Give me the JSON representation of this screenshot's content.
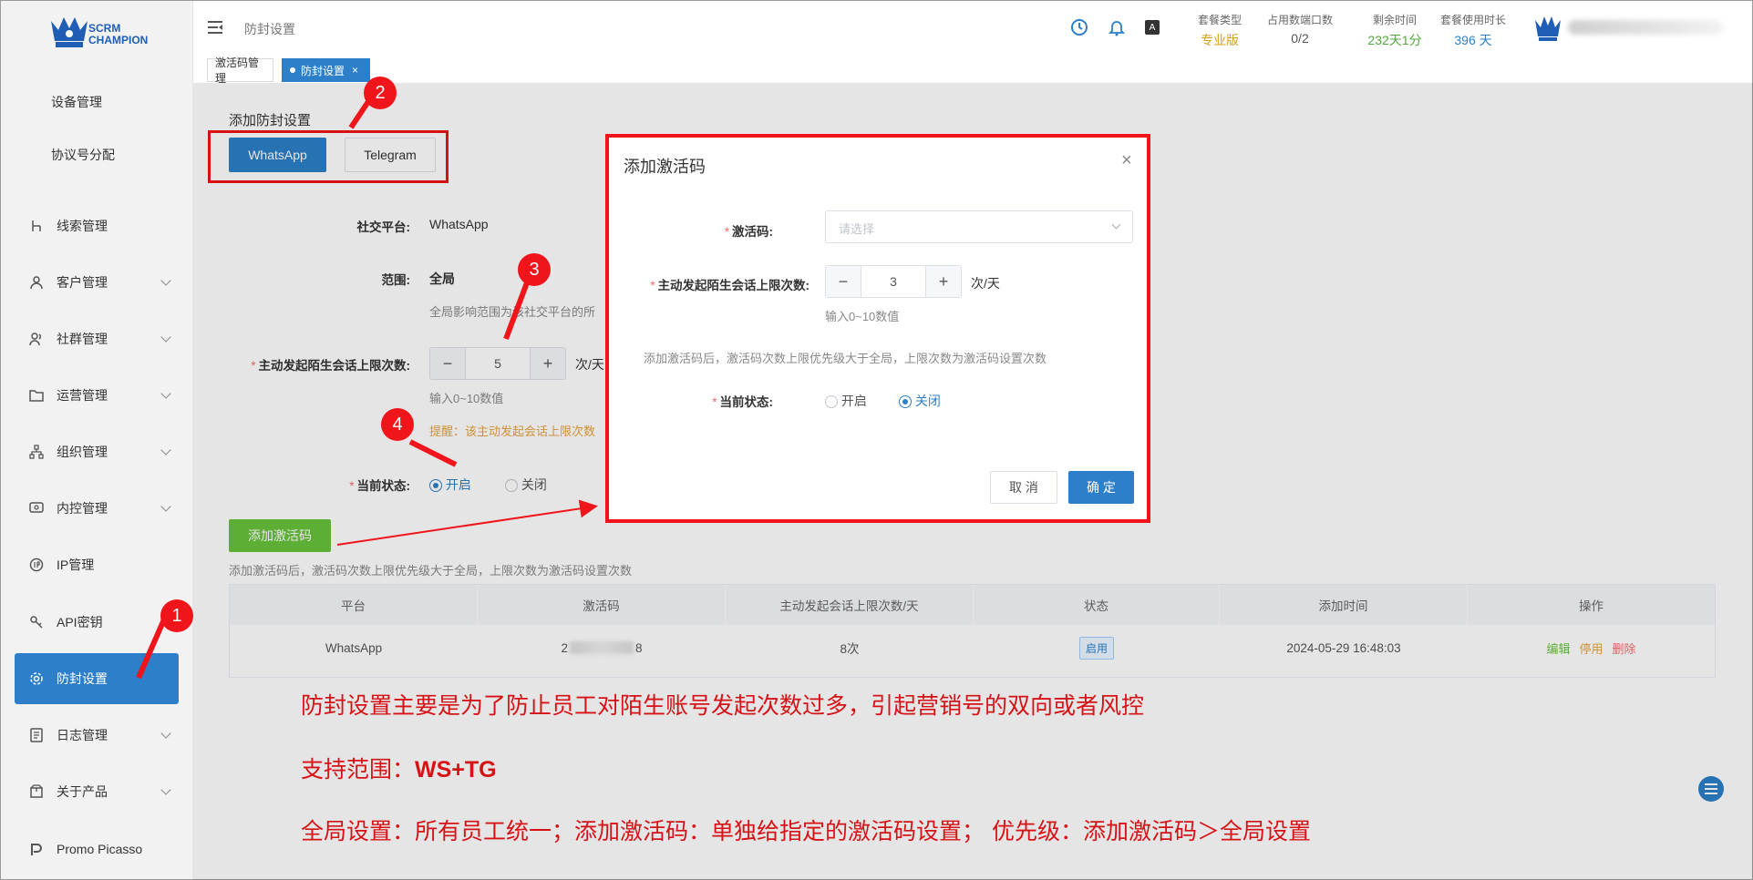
{
  "app": {
    "logo_line1": "SCRM",
    "logo_line2": "CHAMPION"
  },
  "sidebar": {
    "sub_items": [
      "设备管理",
      "协议号分配"
    ],
    "items": [
      {
        "label": "线索管理",
        "icon": "branch-icon",
        "has_children": false
      },
      {
        "label": "客户管理",
        "icon": "user-icon",
        "has_children": true
      },
      {
        "label": "社群管理",
        "icon": "users-icon",
        "has_children": true
      },
      {
        "label": "运营管理",
        "icon": "folder-icon",
        "has_children": true
      },
      {
        "label": "组织管理",
        "icon": "org-icon",
        "has_children": true
      },
      {
        "label": "内控管理",
        "icon": "monitor-icon",
        "has_children": true
      },
      {
        "label": "IP管理",
        "icon": "ip-icon",
        "has_children": false
      },
      {
        "label": "API密钥",
        "icon": "key-icon",
        "has_children": false
      },
      {
        "label": "防封设置",
        "icon": "gear-icon",
        "has_children": false,
        "active": true
      },
      {
        "label": "日志管理",
        "icon": "log-icon",
        "has_children": true
      },
      {
        "label": "关于产品",
        "icon": "package-icon",
        "has_children": true
      },
      {
        "label": "Promo Picasso",
        "icon": "brand-icon",
        "has_children": false
      }
    ]
  },
  "header": {
    "breadcrumb": "防封设置",
    "stats": [
      {
        "label": "套餐类型",
        "value": "专业版",
        "color": "#d4a017"
      },
      {
        "label": "占用数端口数",
        "value": "0/2",
        "color": "#555555"
      },
      {
        "label": "剩余时间",
        "value": "232天1分",
        "color": "#52a93b"
      },
      {
        "label": "套餐使用时长",
        "value": "396 天",
        "color": "#2c7fc8"
      }
    ]
  },
  "tabs": [
    {
      "label": "激活码管理",
      "active": false
    },
    {
      "label": "防封设置",
      "active": true,
      "close": "×"
    }
  ],
  "page": {
    "section_title": "添加防封设置",
    "platform_buttons": [
      "WhatsApp",
      "Telegram"
    ],
    "platform_label": "社交平台:",
    "platform_value": "WhatsApp",
    "scope_label": "范围:",
    "scope_value": "全局",
    "scope_hint": "全局影响范围为该社交平台的所",
    "limit_label": "主动发起陌生会话上限次数:",
    "limit_value": "5",
    "limit_unit": "次/天",
    "limit_hint": "输入0~10数值",
    "reminder": "提醒：该主动发起会话上限次数",
    "status_label": "当前状态:",
    "status_on": "开启",
    "status_off": "关闭",
    "add_code_button": "添加激活码",
    "add_code_hint": "添加激活码后，激活码次数上限优先级大于全局，上限次数为激活码设置次数"
  },
  "table": {
    "columns": [
      "平台",
      "激活码",
      "主动发起会话上限次数/天",
      "状态",
      "添加时间",
      "操作"
    ],
    "rows": [
      {
        "platform": "WhatsApp",
        "code_start": "2",
        "code_end": "8",
        "limit": "8次",
        "status": "启用",
        "time": "2024-05-29 16:48:03",
        "actions": [
          "编辑",
          "停用",
          "删除"
        ]
      }
    ]
  },
  "modal": {
    "title": "添加激活码",
    "close": "×",
    "code_label": "激活码:",
    "code_placeholder": "请选择",
    "limit_label": "主动发起陌生会话上限次数:",
    "limit_value": "3",
    "limit_unit": "次/天",
    "limit_hint": "输入0~10数值",
    "note": "添加激活码后，激活码次数上限优先级大于全局，上限次数为激活码设置次数",
    "status_label": "当前状态:",
    "status_on": "开启",
    "status_off": "关闭",
    "cancel": "取 消",
    "confirm": "确 定"
  },
  "annotations": {
    "markers": [
      "1",
      "2",
      "3",
      "4"
    ],
    "line1": "防封设置主要是为了防止员工对陌生账号发起次数过多，引起营销号的双向或者风控",
    "line2_prefix": "支持范围：",
    "line2_value": "WS+TG",
    "line3": "全局设置：所有员工统一；添加激活码：单独给指定的激活码设置；  优先级：添加激活码＞全局设置"
  },
  "colors": {
    "primary": "#2c7fc8",
    "success": "#67c23a",
    "warning": "#e6a23c",
    "danger": "#f56c6c",
    "annotation": "#f0151a"
  }
}
